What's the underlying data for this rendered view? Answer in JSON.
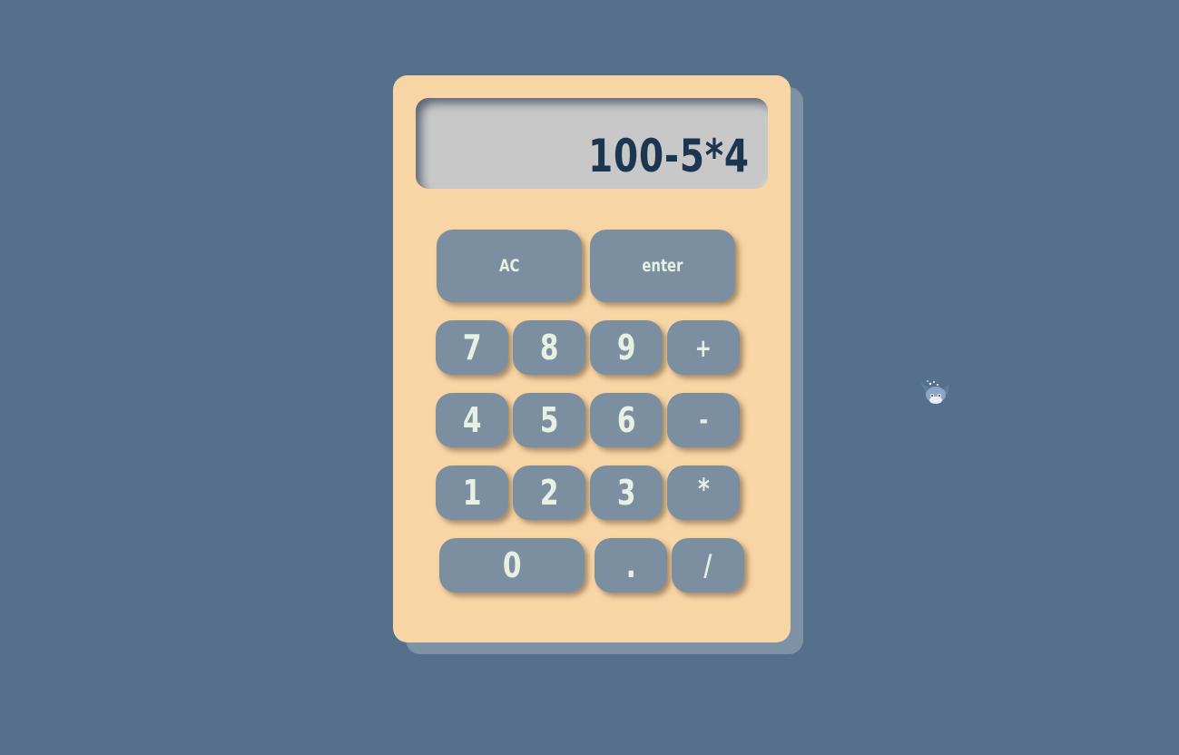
{
  "display": {
    "expression": "100-5*4"
  },
  "keys": {
    "ac": "AC",
    "enter": "enter",
    "seven": "7",
    "eight": "8",
    "nine": "9",
    "plus": "+",
    "four": "4",
    "five": "5",
    "six": "6",
    "minus": "-",
    "one": "1",
    "two": "2",
    "three": "3",
    "multiply": "*",
    "zero": "0",
    "dot": ".",
    "divide": "/"
  },
  "colors": {
    "background": "#56708b",
    "calculator_body": "#f8d5a4",
    "display_bg": "#c8c8c8",
    "display_text": "#1c3550",
    "key_bg": "#7c8fa1",
    "key_text": "#e6f0e3"
  },
  "icons": {
    "mascot": "cartoon-character-icon"
  }
}
